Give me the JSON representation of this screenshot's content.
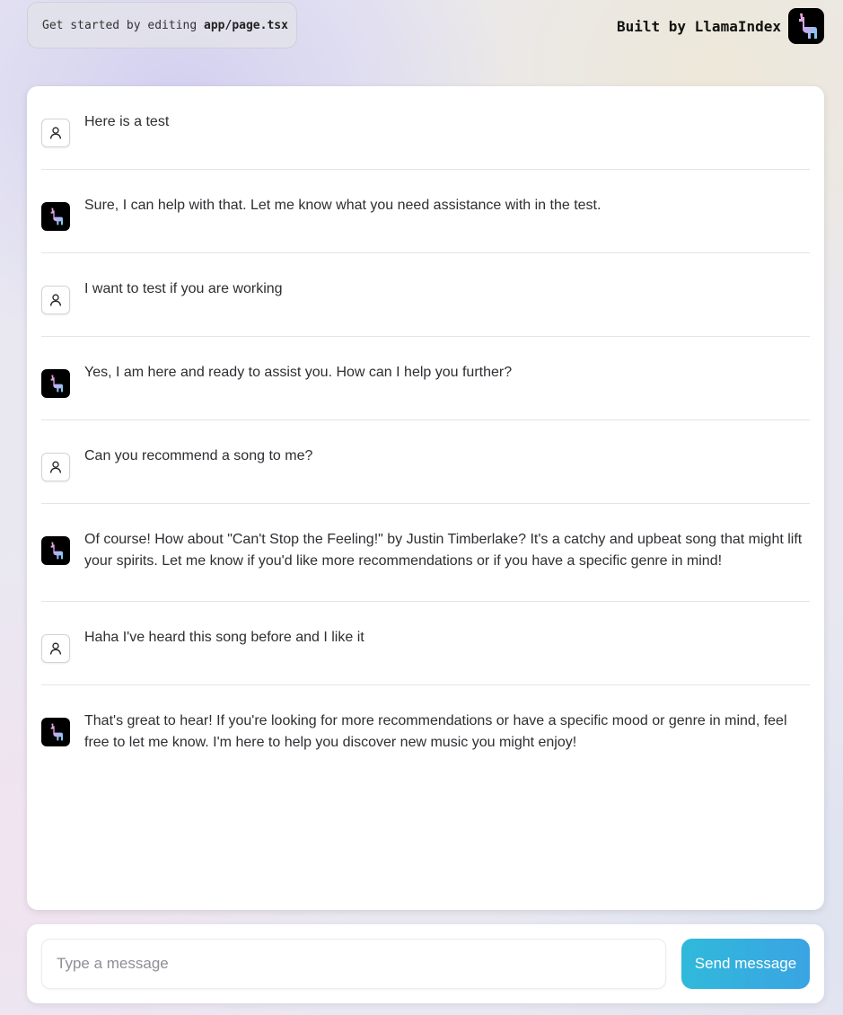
{
  "header": {
    "hint_prefix": "Get started by editing",
    "hint_file": "app/page.tsx",
    "brand_label": "Built by LlamaIndex"
  },
  "icons": {
    "user": "user-icon",
    "bot": "llama-logo-icon",
    "accent": "#3aa4e3"
  },
  "chat": {
    "messages": [
      {
        "role": "user",
        "text": "Here is a test"
      },
      {
        "role": "assistant",
        "text": "Sure, I can help with that. Let me know what you need assistance with in the test."
      },
      {
        "role": "user",
        "text": "I want to test if you are working"
      },
      {
        "role": "assistant",
        "text": "Yes, I am here and ready to assist you. How can I help you further?"
      },
      {
        "role": "user",
        "text": "Can you recommend a song to me?"
      },
      {
        "role": "assistant",
        "text": "Of course! How about \"Can't Stop the Feeling!\" by Justin Timberlake? It's a catchy and upbeat song that might lift your spirits. Let me know if you'd like more recommendations or if you have a specific genre in mind!"
      },
      {
        "role": "user",
        "text": "Haha I've heard this song before and I like it"
      },
      {
        "role": "assistant",
        "text": "That's great to hear! If you're looking for more recommendations or have a specific mood or genre in mind, feel free to let me know. I'm here to help you discover new music you might enjoy!"
      }
    ]
  },
  "composer": {
    "placeholder": "Type a message",
    "value": "",
    "send_label": "Send message"
  }
}
